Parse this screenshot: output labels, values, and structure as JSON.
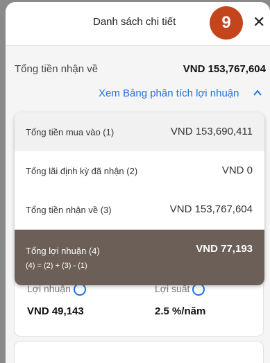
{
  "header": {
    "title": "Danh sách chi tiết",
    "step_badge": "9",
    "close_glyph": "✕"
  },
  "total_received": {
    "label": "Tổng tiền nhận về",
    "value": "VND 153,767,604"
  },
  "profit_link": {
    "label": "Xem Bảng phân tích lợi nhuận"
  },
  "breakdown": {
    "rows": [
      {
        "label": "Tổng tiền mua vào (1)",
        "value": "VND 153,690,411"
      },
      {
        "label": "Tổng lãi định kỳ đã nhận (2)",
        "value": "VND 0"
      },
      {
        "label": "Tổng tiền nhận về (3)",
        "value": "VND 153,767,604"
      }
    ],
    "profit": {
      "label": "Tổng lợi nhuận (4)",
      "value": "VND 77,193",
      "formula": "(4) = (2) + (3) - (1)"
    }
  },
  "background_card": {
    "col1_label": "Lợi nhuận",
    "col2_label": "Lợi suất",
    "col1_value": "VND 49,143",
    "col2_value": "2.5 %/năm"
  },
  "colors": {
    "accent": "#1a73e8",
    "badge": "#c4451c",
    "profit_bg": "#6b5f57"
  },
  "icons": {
    "close": "close-icon",
    "expand": "chevron-up-icon",
    "info": "info-icon"
  }
}
